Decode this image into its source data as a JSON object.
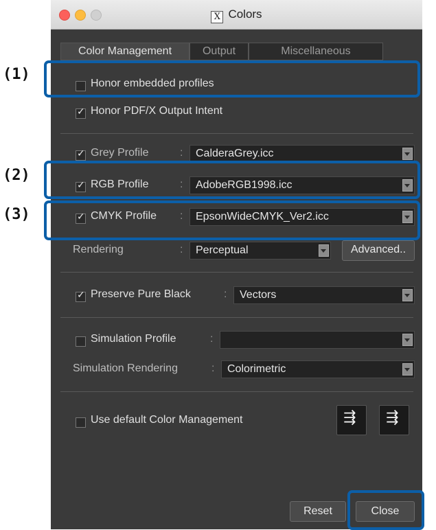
{
  "window": {
    "title": "Colors",
    "title_icon": "X"
  },
  "tabs": [
    {
      "label": "Color Management"
    },
    {
      "label": "Output"
    },
    {
      "label": "Miscellaneous"
    }
  ],
  "color": {
    "honor_embedded": {
      "label": "Honor embedded profiles",
      "checked": false
    },
    "honor_pdfx": {
      "label": "Honor PDF/X Output Intent",
      "checked": true
    },
    "grey": {
      "label": "Grey Profile",
      "value": "CalderaGrey.icc",
      "checked": true
    },
    "rgb": {
      "label": "RGB Profile",
      "value": "AdobeRGB1998.icc",
      "checked": true
    },
    "cmyk": {
      "label": "CMYK Profile",
      "value": "EpsonWideCMYK_Ver2.icc",
      "checked": true
    },
    "rendering": {
      "label": "Rendering",
      "value": "Perceptual",
      "advanced_label": "Advanced.."
    },
    "preserve_black": {
      "label": "Preserve Pure Black",
      "value": "Vectors",
      "checked": true
    },
    "simulation_profile": {
      "label": "Simulation Profile",
      "value": "",
      "checked": false
    },
    "simulation_rendering": {
      "label": "Simulation Rendering",
      "value": "Colorimetric"
    },
    "use_default": {
      "label": "Use default Color Management",
      "checked": false
    },
    "colon": ":"
  },
  "footer": {
    "reset_label": "Reset",
    "close_label": "Close"
  },
  "callouts": {
    "one": "(1)",
    "two": "(2)",
    "three": "(3)"
  },
  "colors": {
    "annotation": "#0c5fa8",
    "panel": "#3a3a3a"
  }
}
